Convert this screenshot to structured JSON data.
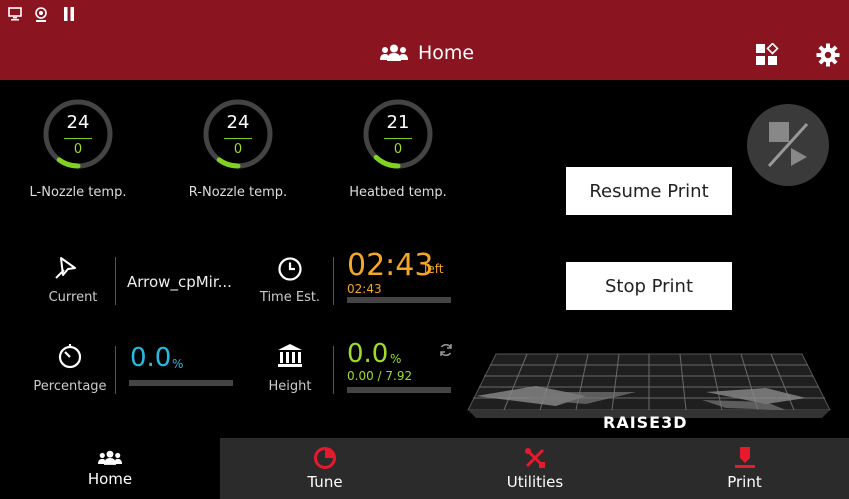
{
  "header": {
    "title": "Home",
    "accent": "#8a1420"
  },
  "gauges": [
    {
      "target": "24",
      "current": "0",
      "label": "L-Nozzle temp.",
      "level": 0.1
    },
    {
      "target": "24",
      "current": "0",
      "label": "R-Nozzle temp.",
      "level": 0.1
    },
    {
      "target": "21",
      "current": "0",
      "label": "Heatbed temp.",
      "level": 0.12
    }
  ],
  "current": {
    "label": "Current",
    "file": "Arrow_cpMir...",
    "icon": "pin-icon"
  },
  "time": {
    "label": "Time Est.",
    "value": "02:43",
    "suffix": "left",
    "sub": "02:43",
    "color": "#f5a623",
    "icon": "clock-icon"
  },
  "percentage": {
    "label": "Percentage",
    "value": "0.0",
    "unit": "%",
    "color": "#26b9e6",
    "progress": 0.0,
    "icon": "timer-icon"
  },
  "height": {
    "label": "Height",
    "value": "0.0",
    "unit": "%",
    "sub": "0.00 / 7.92",
    "color": "#9ddc2c",
    "progress": 0.0,
    "icon": "building-icon"
  },
  "actions": {
    "resume": "Resume Print",
    "stop": "Stop Print"
  },
  "brand": "RAISE3D",
  "nav": [
    {
      "label": "Home",
      "icon": "users-icon",
      "active": true
    },
    {
      "label": "Tune",
      "icon": "pie-icon",
      "active": false
    },
    {
      "label": "Utilities",
      "icon": "tools-icon",
      "active": false
    },
    {
      "label": "Print",
      "icon": "print-icon",
      "active": false
    }
  ]
}
